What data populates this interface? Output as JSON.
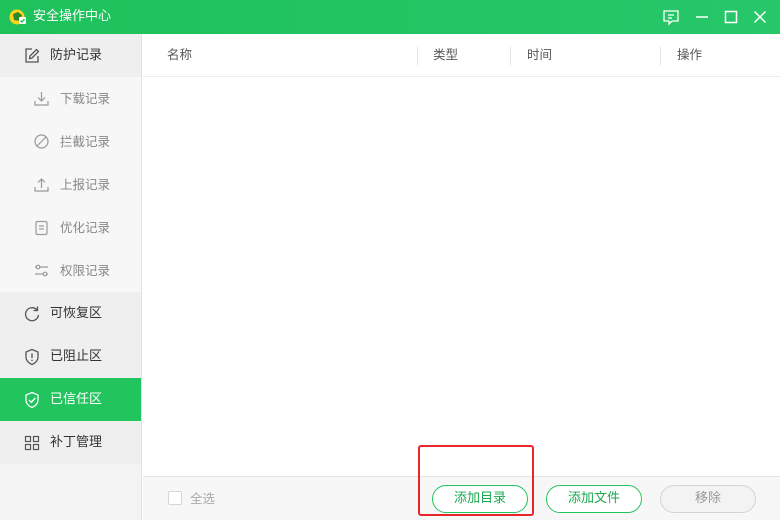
{
  "window": {
    "title": "安全操作中心",
    "accent": "#22c45e",
    "controls": [
      "feedback-icon",
      "minimize-icon",
      "maximize-icon",
      "close-icon"
    ]
  },
  "sidebar": {
    "items": [
      {
        "label": "防护记录",
        "icon": "edit-icon",
        "level": "group"
      },
      {
        "label": "下载记录",
        "icon": "download-icon",
        "level": "sub"
      },
      {
        "label": "拦截记录",
        "icon": "block-icon",
        "level": "sub"
      },
      {
        "label": "上报记录",
        "icon": "upload-icon",
        "level": "sub"
      },
      {
        "label": "优化记录",
        "icon": "clipboard-icon",
        "level": "sub"
      },
      {
        "label": "权限记录",
        "icon": "slider-icon",
        "level": "sub"
      },
      {
        "label": "可恢复区",
        "icon": "refresh-icon",
        "level": "group"
      },
      {
        "label": "已阻止区",
        "icon": "shield-alert-icon",
        "level": "group"
      },
      {
        "label": "已信任区",
        "icon": "shield-check-icon",
        "level": "group",
        "active": true
      },
      {
        "label": "补丁管理",
        "icon": "grid-icon",
        "level": "group"
      }
    ]
  },
  "table": {
    "columns": [
      "名称",
      "类型",
      "时间",
      "操作"
    ],
    "rows": []
  },
  "footer": {
    "select_all_label": "全选",
    "add_dir_label": "添加目录",
    "add_file_label": "添加文件",
    "remove_label": "移除"
  }
}
